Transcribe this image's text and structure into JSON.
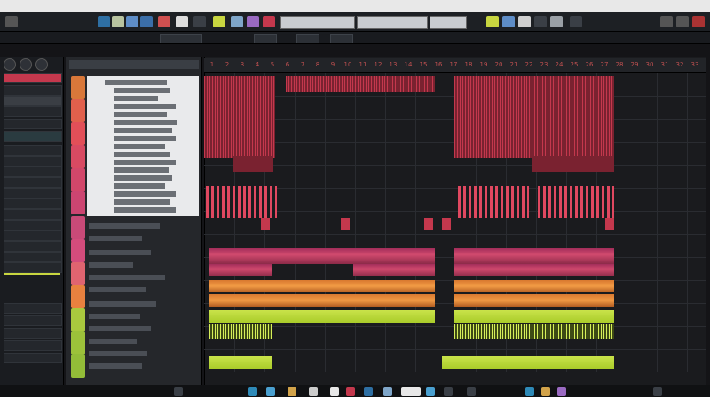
{
  "project_label": "",
  "ruler": {
    "bar_numbers": [
      "1",
      "2",
      "3",
      "4",
      "5",
      "6",
      "7",
      "8",
      "9",
      "10",
      "11",
      "12",
      "13",
      "14",
      "15",
      "16",
      "17",
      "18",
      "19",
      "20",
      "21",
      "22",
      "23",
      "24",
      "25",
      "26",
      "27",
      "28",
      "29",
      "30",
      "31",
      "32",
      "33"
    ]
  },
  "browser": {
    "items": [
      "",
      "",
      "",
      "",
      "",
      "",
      "",
      "",
      "",
      "",
      "",
      "",
      "",
      "",
      "",
      "",
      ""
    ]
  },
  "colors": {
    "track_red": "#c4384d",
    "track_pink": "#d14a6e",
    "track_orange": "#f29b45",
    "track_lime": "#c9e34a"
  },
  "icons": [
    "menu-icon",
    "play-icon",
    "stop-icon",
    "record-icon",
    "save-icon",
    "folder-icon",
    "mixer-icon",
    "piano-roll-icon",
    "playlist-icon",
    "browser-icon"
  ]
}
